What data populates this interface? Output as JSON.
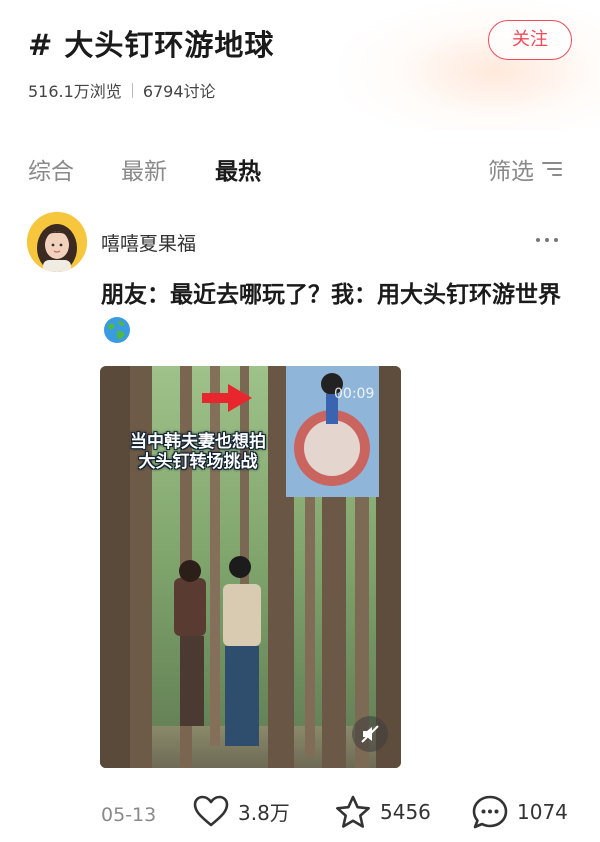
{
  "topic": {
    "title": "# 大头钉环游地球",
    "follow_label": "关注",
    "views": "516.1万浏览",
    "discussions": "6794讨论"
  },
  "tabs": [
    {
      "label": "综合",
      "active": false
    },
    {
      "label": "最新",
      "active": false
    },
    {
      "label": "最热",
      "active": true
    }
  ],
  "filter": {
    "label": "筛选",
    "icon": "filter-lines-icon"
  },
  "post": {
    "author": "嘻嘻夏果福",
    "text": "朋友：最近去哪玩了？我：用大头钉环游世界",
    "text_emoji": "globe-icon",
    "video": {
      "caption_line1": "当中韩夫妻也想拍",
      "caption_line2": "大头钉转场挑战",
      "timestamp": "00:09",
      "arrow_color": "#e8262e"
    },
    "date": "05-13",
    "likes": "3.8万",
    "favorites": "5456",
    "comments": "1074"
  },
  "colors": {
    "accent": "#f04a5a",
    "tab_inactive": "#8a8a8a",
    "text_primary": "#1a1a1a"
  }
}
